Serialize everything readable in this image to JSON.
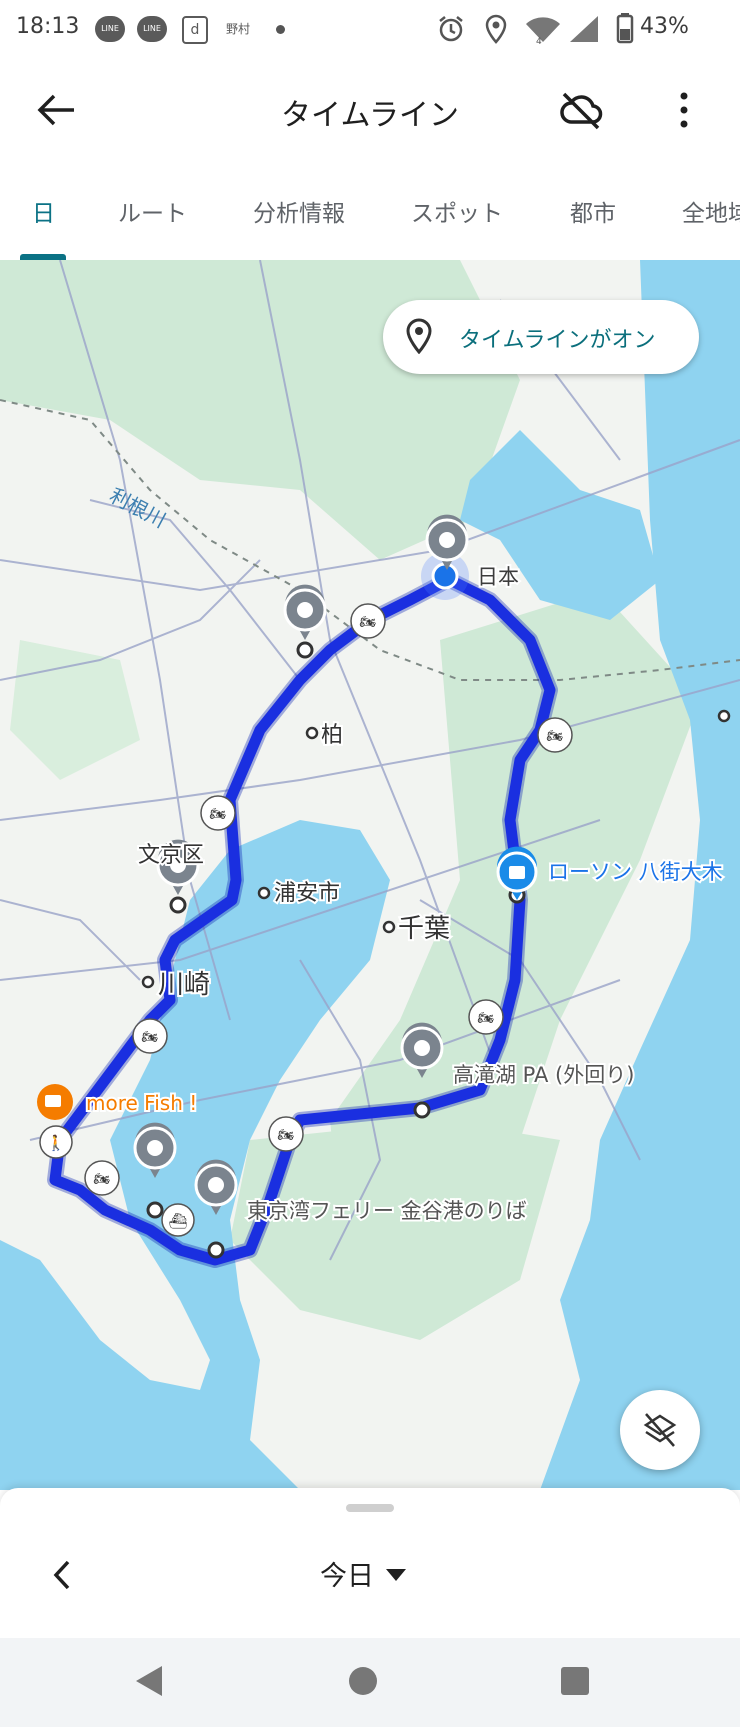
{
  "status_bar": {
    "time": "18:13",
    "apps": [
      "LINE",
      "LINE",
      "d",
      "野村"
    ],
    "battery": "43%"
  },
  "header": {
    "title": "タイムライン"
  },
  "tabs": [
    {
      "label": "日",
      "active": true
    },
    {
      "label": "ルート"
    },
    {
      "label": "分析情報"
    },
    {
      "label": "スポット"
    },
    {
      "label": "都市"
    },
    {
      "label": "全地域"
    }
  ],
  "map": {
    "chip_label": "タイムラインがオン",
    "labels": {
      "river": "利根川",
      "japan": "日本",
      "kashiwa": "柏",
      "bunkyo": "文京区",
      "urayasu": "浦安市",
      "chiba": "千葉",
      "kawasaki": "川崎",
      "lawson": "ローソン 八街大木",
      "takataki": "高滝湖 PA (外回り)",
      "ferry": "東京湾フェリー 金谷港のりば",
      "cafe": "more Fish !"
    },
    "colors": {
      "route": "#1a2fe0",
      "route_glow": "#0a1fb3",
      "water": "#8fd3f0",
      "land": "#f2f4f1",
      "green": "#cfe9d6",
      "accent": "#0b7285",
      "cafe": "#f57c00",
      "shop": "#1a8be8"
    }
  },
  "bottom_sheet": {
    "date": "今日"
  }
}
